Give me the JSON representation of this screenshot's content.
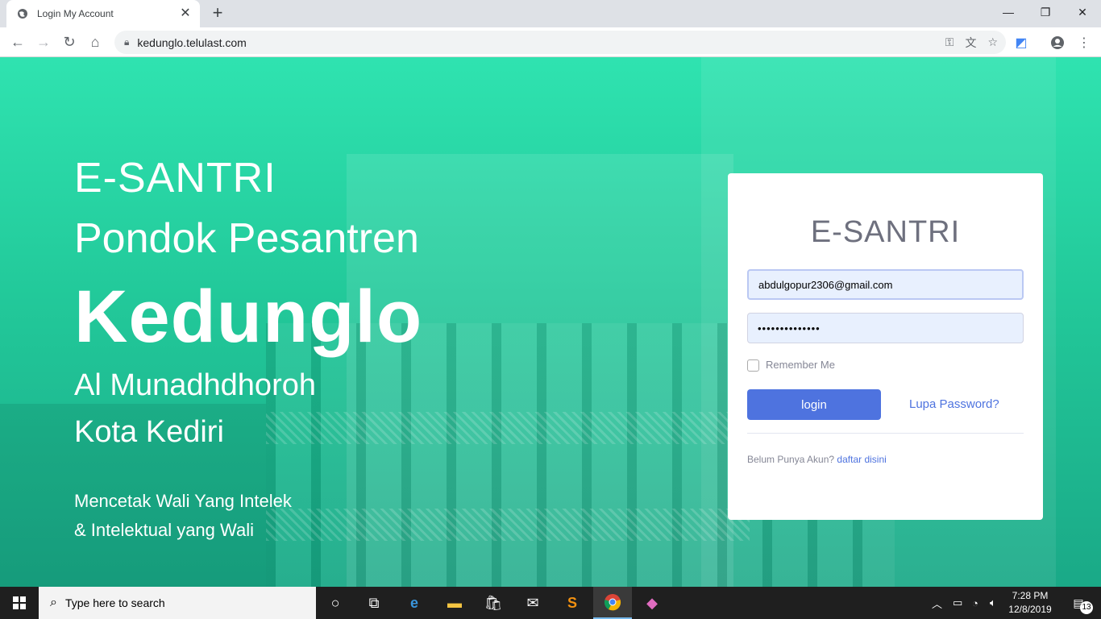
{
  "browser": {
    "tab_title": "Login My Account",
    "url": "kedunglo.telulast.com",
    "icons": [
      "globe-icon",
      "close-icon",
      "plus-icon",
      "back-icon",
      "forward-icon",
      "reload-icon",
      "home-icon",
      "lock-icon",
      "key-icon",
      "translate-icon",
      "star-icon",
      "extension-icon",
      "profile-icon",
      "menu-icon",
      "minimize-icon",
      "maximize-icon",
      "close-window-icon"
    ]
  },
  "hero": {
    "line1": "E-SANTRI",
    "line2": "Pondok Pesantren",
    "line3": "Kedunglo",
    "line4": "Al Munadhdhoroh",
    "line5": "Kota Kediri",
    "tagline1": "Mencetak Wali Yang Intelek",
    "tagline2": "& Intelektual yang Wali"
  },
  "login": {
    "title": "E-SANTRI",
    "email_value": "abdulgopur2306@gmail.com",
    "password_value": "••••••••••••••",
    "remember_label": "Remember Me",
    "login_button": "login",
    "forgot_link": "Lupa Password?",
    "register_prompt": "Belum Punya Akun?",
    "register_link": "daftar disini"
  },
  "taskbar": {
    "search_placeholder": "Type here to search",
    "time": "7:28 PM",
    "date": "12/8/2019",
    "notification_count": "13"
  },
  "colors": {
    "accent": "#4e73df",
    "hero_green": "#2fe3b0",
    "taskbar": "#1f1f1f"
  }
}
